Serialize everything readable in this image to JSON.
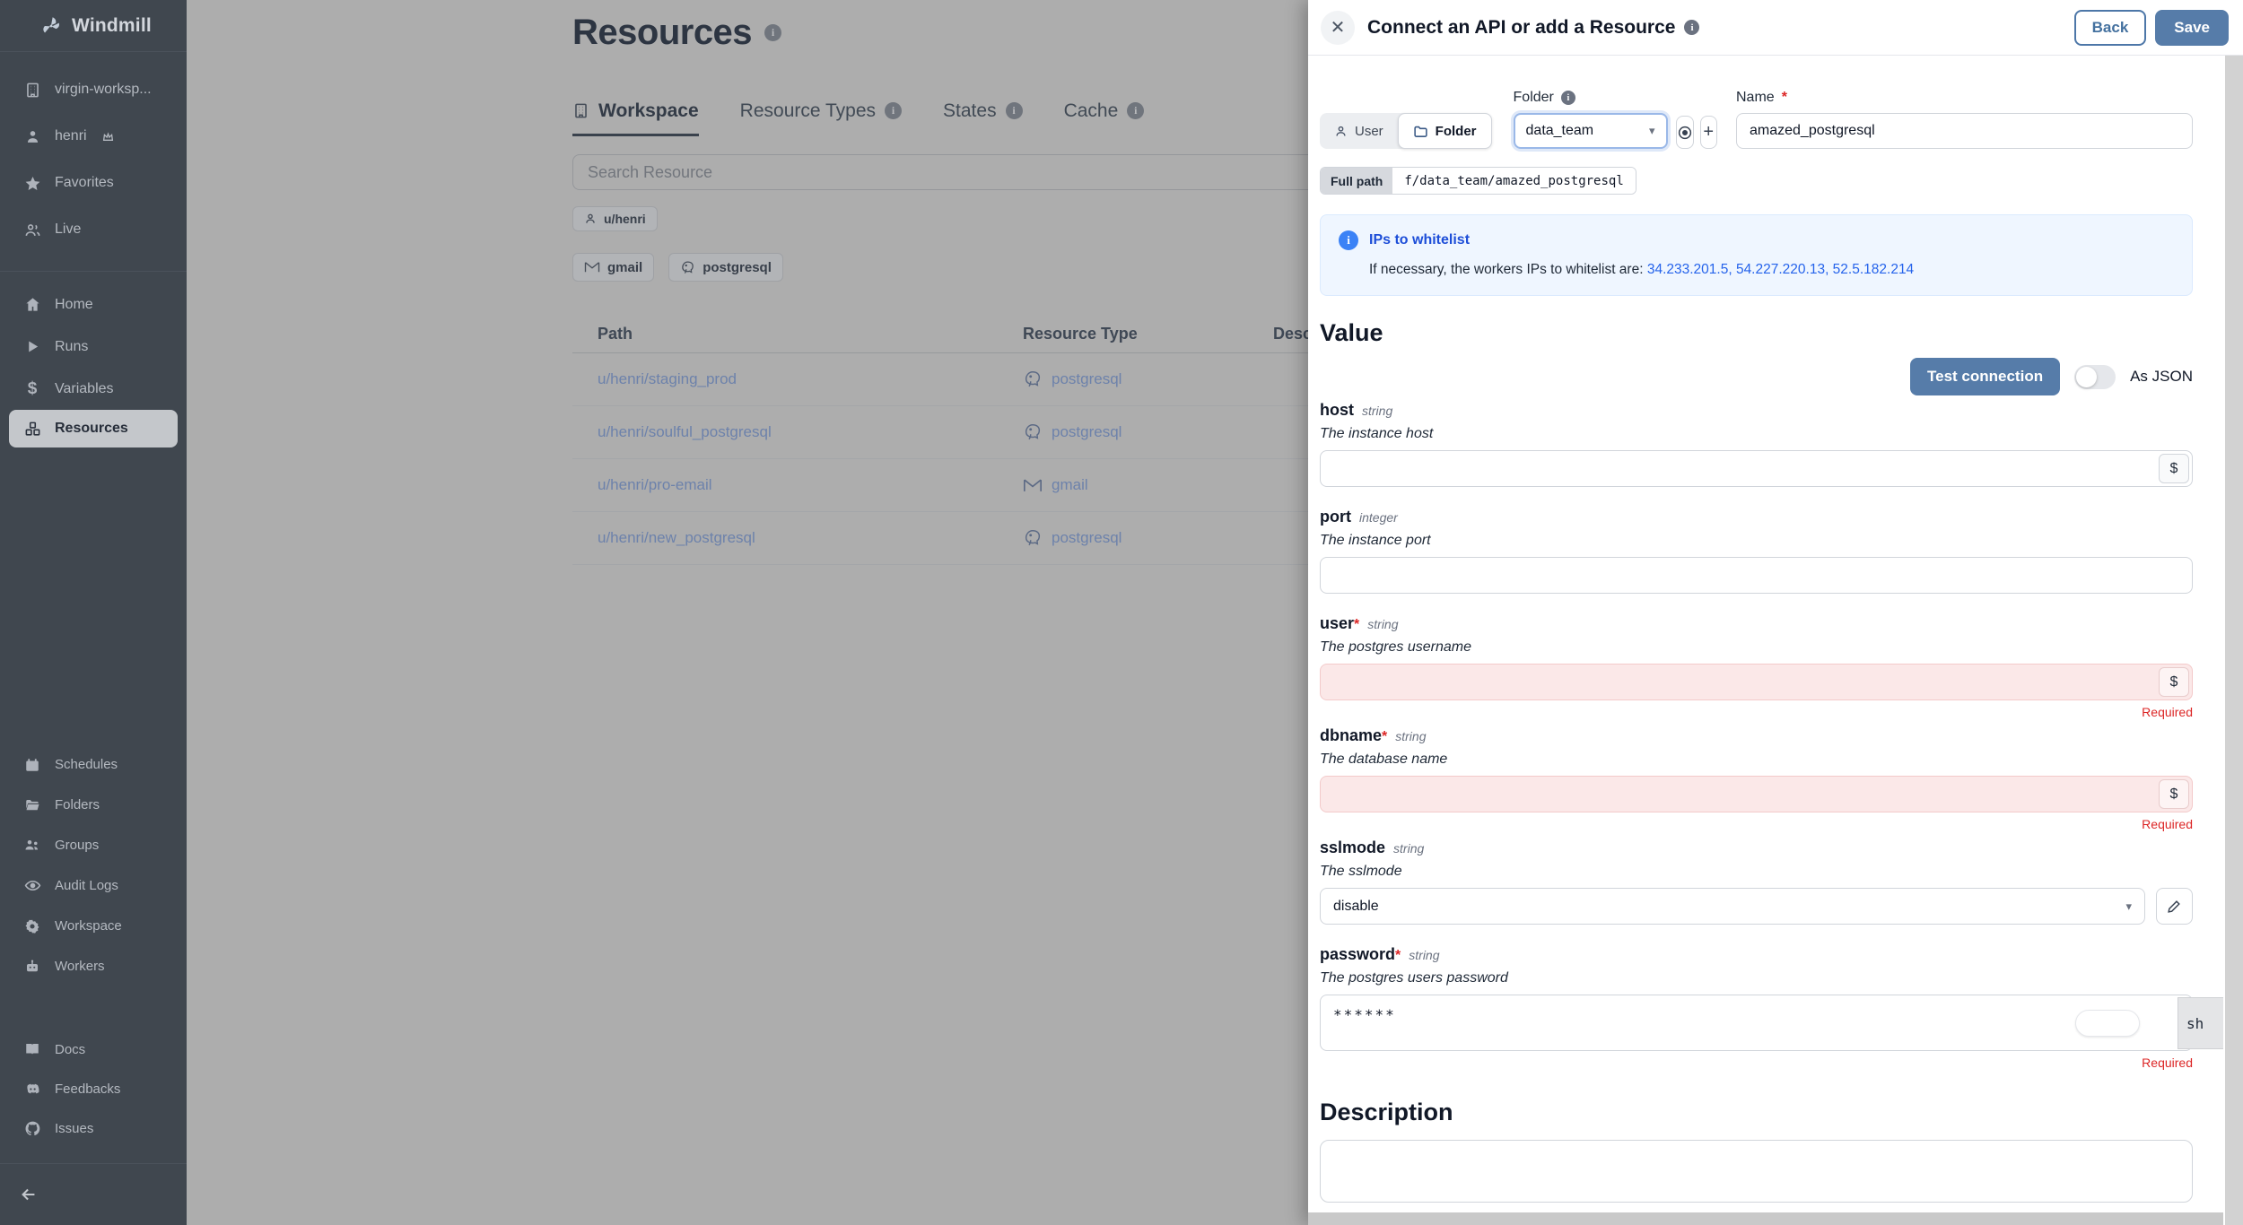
{
  "colors": {
    "accent_steel": "#567ca9",
    "link_blue": "#2563eb",
    "error_red": "#dc2626",
    "sidebar_bg": "#40474f",
    "alert_bg": "#eff6ff"
  },
  "sidebar": {
    "brand": "Windmill",
    "workspace_name": "virgin-worksp...",
    "user_name": "henri",
    "favorites": "Favorites",
    "live": "Live",
    "nav_primary": [
      {
        "label": "Home"
      },
      {
        "label": "Runs"
      },
      {
        "label": "Variables"
      },
      {
        "label": "Resources"
      }
    ],
    "nav_secondary": [
      {
        "label": "Schedules"
      },
      {
        "label": "Folders"
      },
      {
        "label": "Groups"
      },
      {
        "label": "Audit Logs"
      },
      {
        "label": "Workspace"
      },
      {
        "label": "Workers"
      }
    ],
    "nav_footer": [
      {
        "label": "Docs"
      },
      {
        "label": "Feedbacks"
      },
      {
        "label": "Issues"
      }
    ]
  },
  "main": {
    "title": "Resources",
    "tabs": [
      {
        "label": "Workspace"
      },
      {
        "label": "Resource Types"
      },
      {
        "label": "States"
      },
      {
        "label": "Cache"
      }
    ],
    "search_placeholder": "Search Resource",
    "owner_chip": "u/henri",
    "type_chips": [
      {
        "label": "gmail"
      },
      {
        "label": "postgresql"
      }
    ],
    "table": {
      "headers": {
        "path": "Path",
        "type": "Resource Type",
        "description": "Description"
      },
      "rows": [
        {
          "path": "u/henri/staging_prod",
          "type": "postgresql"
        },
        {
          "path": "u/henri/soulful_postgresql",
          "type": "postgresql"
        },
        {
          "path": "u/henri/pro-email",
          "type": "gmail"
        },
        {
          "path": "u/henri/new_postgresql",
          "type": "postgresql"
        }
      ]
    }
  },
  "drawer": {
    "title": "Connect an API or add a Resource",
    "back_label": "Back",
    "save_label": "Save",
    "scope": {
      "user": "User",
      "folder": "Folder"
    },
    "folder_label": "Folder",
    "folder_value": "data_team",
    "name_label": "Name",
    "required_mark": "*",
    "name_value": "amazed_postgresql",
    "full_path_label": "Full path",
    "full_path_value": "f/data_team/amazed_postgresql",
    "alert": {
      "title": "IPs to whitelist",
      "text": "If necessary, the workers IPs to whitelist are: ",
      "ips": "34.233.201.5, 54.227.220.13, 52.5.182.214"
    },
    "value_heading": "Value",
    "test_connection_label": "Test connection",
    "as_json_label": "As JSON",
    "variable_symbol": "$",
    "fields": [
      {
        "label": "host",
        "type": "string",
        "desc": "The instance host"
      },
      {
        "label": "port",
        "type": "integer",
        "desc": "The instance port"
      },
      {
        "label": "user",
        "mark": "*",
        "type": "string",
        "desc": "The postgres username",
        "error": "Required"
      },
      {
        "label": "dbname",
        "mark": "*",
        "type": "string",
        "desc": "The database name",
        "error": "Required"
      },
      {
        "label": "sslmode",
        "type": "string",
        "desc": "The sslmode",
        "value": "disable"
      },
      {
        "label": "password",
        "mark": "*",
        "type": "string",
        "desc": "The postgres users password",
        "value": "******",
        "error": "Required",
        "show_tag": "sh"
      }
    ],
    "description_heading": "Description"
  }
}
